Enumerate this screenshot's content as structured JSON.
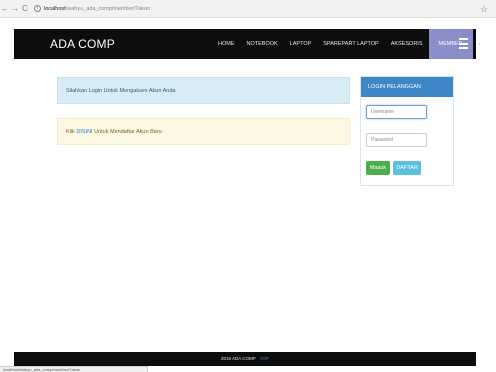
{
  "browser": {
    "back": "←",
    "forward": "→",
    "reload": "C",
    "info": "i",
    "url_host": "localhost",
    "url_path": "/wahyu_ada_comp/member/?akun",
    "star": "☆"
  },
  "navbar": {
    "brand": "ADA COMP",
    "items": [
      {
        "label": "HOME"
      },
      {
        "label": "NOTEBOOK"
      },
      {
        "label": "LAPTOP"
      },
      {
        "label": "SPAREPART LAPTOP"
      },
      {
        "label": "AKSESORIS"
      },
      {
        "label": "MEMBER"
      }
    ],
    "caret": "▾"
  },
  "alerts": {
    "login_prompt": "Silahkan Login Untuk Mengakses Akun Anda",
    "register_pre": "Klik ",
    "register_link": "DISINI",
    "register_post": " Untuk Mendaftar Akun Baru"
  },
  "login_panel": {
    "heading": "LOGIN PELANGGAN",
    "username_placeholder": "Username",
    "password_placeholder": "Password",
    "masuk_label": "Masuk",
    "daftar_label": "DAFTAR"
  },
  "footer": {
    "copyright": "2016 ADA COMP",
    "top_link": "TOP"
  },
  "status_bar": {
    "url": "localhost/wahyu_ada_comp/member/?akun"
  },
  "colors": {
    "navbar_bg": "#0d0d0d",
    "active_menu": "#8a8ec8",
    "panel_heading": "#3f86c6",
    "btn_masuk": "#4cae4c",
    "btn_daftar": "#5bc0de"
  }
}
